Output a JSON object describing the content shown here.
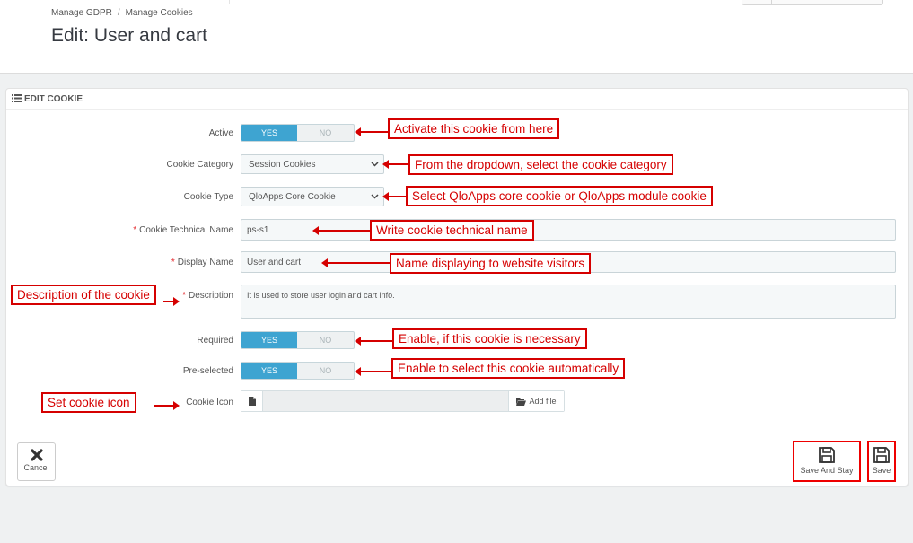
{
  "breadcrumb": {
    "item1": "Manage GDPR",
    "separator": "/",
    "item2": "Manage Cookies"
  },
  "page_title": "Edit: User and cart",
  "panel": {
    "heading": "EDIT COOKIE",
    "heading_icon": "list-icon"
  },
  "form": {
    "active": {
      "label": "Active",
      "yes": "YES",
      "no": "NO",
      "value": "YES"
    },
    "category": {
      "label": "Cookie Category",
      "value": "Session Cookies"
    },
    "type": {
      "label": "Cookie Type",
      "value": "QloApps Core Cookie"
    },
    "technical_name": {
      "required": "*",
      "label": "Cookie Technical Name",
      "value": "ps-s1"
    },
    "display_name": {
      "required": "*",
      "label": "Display Name",
      "value": "User and cart"
    },
    "description": {
      "required": "*",
      "label": "Description",
      "value": "It is used to store user login and cart info."
    },
    "required_field": {
      "label": "Required",
      "yes": "YES",
      "no": "NO",
      "value": "YES"
    },
    "preselected": {
      "label": "Pre-selected",
      "yes": "YES",
      "no": "NO",
      "value": "YES"
    },
    "icon": {
      "label": "Cookie Icon",
      "add_file": "Add file"
    }
  },
  "buttons": {
    "cancel": "Cancel",
    "save_and_stay": "Save And Stay",
    "save": "Save"
  },
  "annotations": {
    "active": "Activate this cookie from here",
    "category": "From the dropdown, select the cookie category",
    "type": "Select QloApps core cookie or QloApps module cookie",
    "technical_name": "Write cookie technical name",
    "display_name": "Name displaying to website visitors",
    "description": "Description of the cookie",
    "required": "Enable, if this cookie is necessary",
    "preselected": "Enable to select this cookie automatically",
    "icon": "Set cookie icon"
  },
  "colors": {
    "accent": "#3ea4d1",
    "annotation": "#d50000",
    "required_star": "#e4282c"
  }
}
